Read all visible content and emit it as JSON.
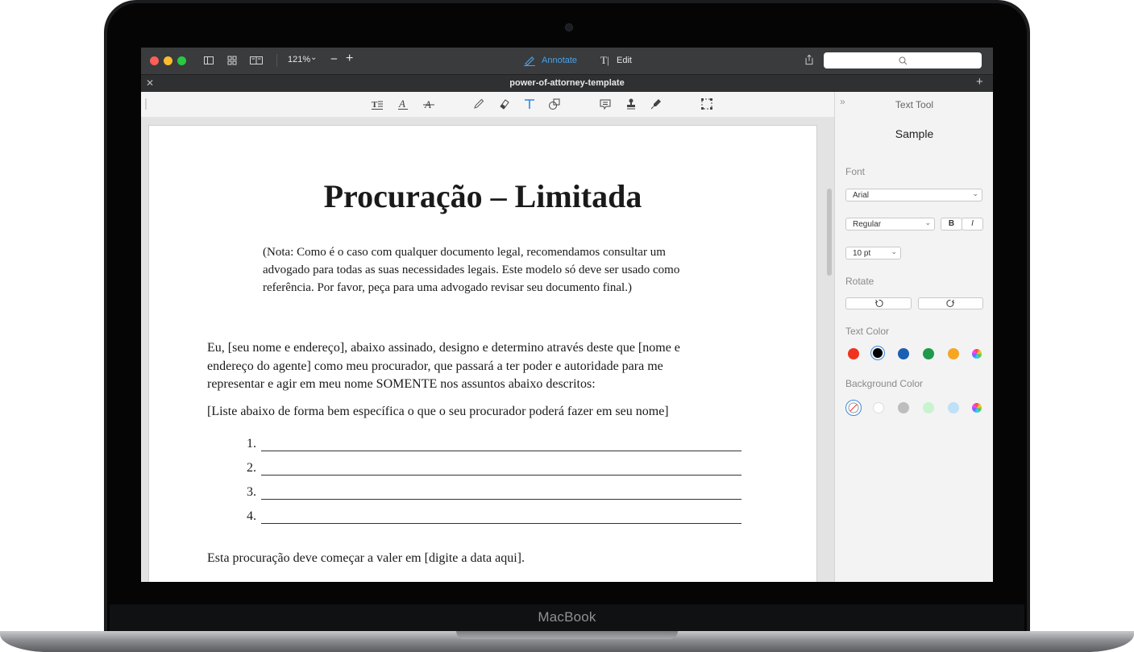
{
  "laptop": {
    "brand": "MacBook"
  },
  "toolbar": {
    "zoom": "121%",
    "annotate_label": "Annotate",
    "edit_label": "Edit",
    "search_placeholder": "",
    "traffic_colors": [
      "#fc5f57",
      "#fdbc2e",
      "#29c940"
    ],
    "accent": "#4aa0e8"
  },
  "tab": {
    "title": "power-of-attorney-template"
  },
  "annotation_tools": [
    "text-box-icon",
    "underline-icon",
    "strikethrough-icon",
    "pencil-icon",
    "eraser-icon",
    "text-tool-icon",
    "shapes-icon",
    "note-icon",
    "stamp-icon",
    "signature-icon",
    "selection-icon"
  ],
  "document": {
    "title": "Procuração – Limitada",
    "note": [
      "(Nota: Como é o caso com qualquer documento legal, recomendamos consultar um",
      "advogado para todas as suas necessidades legais. Este modelo só deve ser usado como",
      "referência. Por favor, peça para uma advogado revisar seu documento final.)"
    ],
    "para1": [
      "Eu, [seu nome e endereço], abaixo assinado, designo e determino através deste que [nome e",
      "endereço do agente] como meu procurador, que passará a ter poder e autoridade para me",
      "representar e agir em meu nome SOMENTE nos assuntos abaixo descritos:"
    ],
    "para2": "[Liste abaixo de forma bem específica o que o seu procurador poderá fazer em seu nome]",
    "list_numbers": [
      "1.",
      "2.",
      "3.",
      "4."
    ],
    "para3": "Esta procuração deve começar a valer em [digite a data aqui]."
  },
  "panel": {
    "title": "Text Tool",
    "sample": "Sample",
    "font_label": "Font",
    "font_value": "Arial",
    "style_value": "Regular",
    "bold": "B",
    "italic": "I",
    "size_value": "10 pt",
    "rotate_label": "Rotate",
    "text_color_label": "Text Color",
    "text_colors": [
      "#f0321e",
      "#000000",
      "#1a5fb4",
      "#1e9a4a",
      "#f5a623"
    ],
    "bg_color_label": "Background Color",
    "bg_colors": [
      "#ffffff",
      "#bdbdbd",
      "#c8f3cf",
      "#bfe0f7"
    ]
  }
}
